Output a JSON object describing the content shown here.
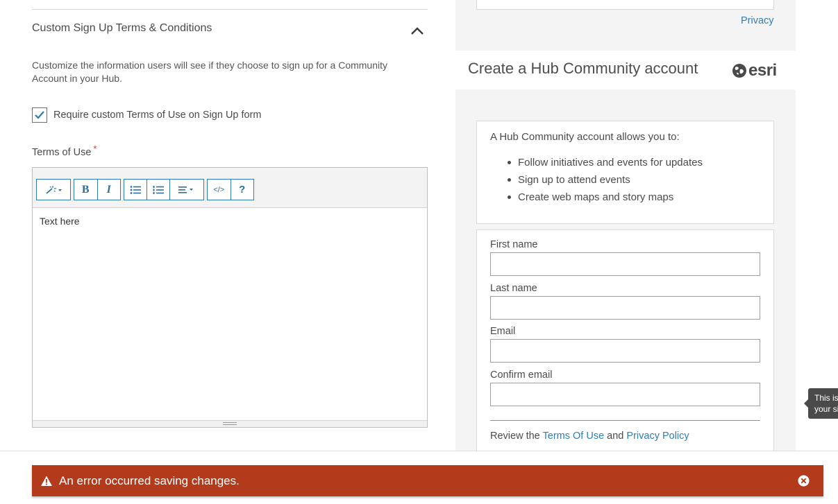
{
  "settings": {
    "section_title": "Custom Sign Up Terms & Conditions",
    "description": "Customize the information users will see if they choose to sign up for a Community Account in your Hub.",
    "checkbox_label": "Require custom Terms of Use on Sign Up form",
    "checkbox_checked": true,
    "terms_label": "Terms of Use",
    "required_marker": "*",
    "editor_text": "Text here",
    "toolbar": {
      "bold_label": "B",
      "italic_label": "I",
      "code_label": "</>",
      "help_label": "?"
    }
  },
  "preview": {
    "privacy_link": "Privacy",
    "title": "Create a Hub Community account",
    "logo_text": "esri",
    "info_intro": "A Hub Community account allows you to:",
    "benefits": [
      "Follow initiatives and events for updates",
      "Sign up to attend events",
      "Create web maps and story maps"
    ],
    "fields": {
      "first_name": "First name",
      "last_name": "Last name",
      "email": "Email",
      "confirm_email": "Confirm email"
    },
    "review": {
      "prefix": "Review the",
      "terms_link": "Terms Of Use",
      "conjunction": "and",
      "privacy_link": "Privacy Policy"
    }
  },
  "tooltip": {
    "text_line1": "This is",
    "text_line2": "your si"
  },
  "alert": {
    "message": "An error occurred saving changes.",
    "color": "#b33a1b"
  },
  "colors": {
    "link": "#2f7db3",
    "toolbar_accent": "#2d7bb0",
    "panel_bg": "#f4f4f4"
  }
}
